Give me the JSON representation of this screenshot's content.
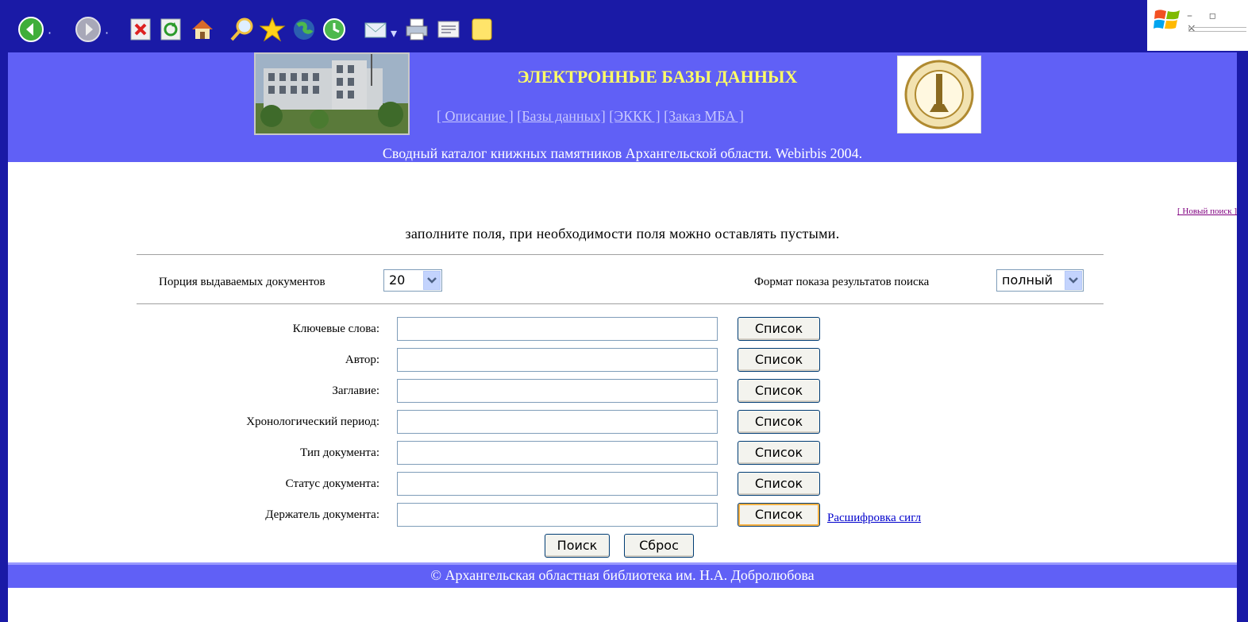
{
  "toolbar": {
    "items": [
      {
        "name": "back-icon",
        "dropdown": true
      },
      {
        "name": "forward-icon",
        "dropdown": true
      },
      {
        "name": "stop-icon"
      },
      {
        "name": "refresh-icon"
      },
      {
        "name": "home-icon"
      },
      {
        "name": "search-icon"
      },
      {
        "name": "favorites-icon"
      },
      {
        "name": "media-icon"
      },
      {
        "name": "history-icon"
      },
      {
        "name": "mail-icon",
        "dropdown": true
      },
      {
        "name": "print-icon"
      },
      {
        "name": "edit-icon"
      },
      {
        "name": "discuss-icon"
      }
    ],
    "window_controls": "– ▫ ×"
  },
  "header": {
    "title": "ЭЛЕКТРОННЫЕ БАЗЫ ДАННЫХ",
    "nav": [
      {
        "label": "[ Описание ]"
      },
      {
        "label": "[Базы данных]"
      },
      {
        "label": "[ЭККК ]"
      },
      {
        "label": "[Заказ МБА ]"
      }
    ],
    "subtitle": "Сводный каталог книжных памятников Архангельской области. Webirbis 2004."
  },
  "new_search": "[ Новый поиск ]",
  "instruction": "заполните поля, при необходимости поля можно оставлять пустыми.",
  "options": {
    "portion_label": "Порция выдаваемых документов",
    "portion_value": "20",
    "format_label": "Формат показа результатов поиска",
    "format_value": "полный"
  },
  "fields": [
    {
      "label": "Ключевые слова:",
      "value": "",
      "list_button": "Список"
    },
    {
      "label": "Автор:",
      "value": "",
      "list_button": "Список"
    },
    {
      "label": "Заглавие:",
      "value": "",
      "list_button": "Список"
    },
    {
      "label": "Хронологический период:",
      "value": "",
      "list_button": "Список"
    },
    {
      "label": "Тип документа:",
      "value": "",
      "list_button": "Список"
    },
    {
      "label": "Статус документа:",
      "value": "",
      "list_button": "Список"
    },
    {
      "label": "Держатель документа:",
      "value": "",
      "list_button": "Список"
    }
  ],
  "decode_link": "Расшифровка сигл",
  "search_button": "Поиск",
  "reset_button": "Сброс",
  "footer": "© Архангельская областная библиотека им. Н.А. Добролюбова",
  "colors": {
    "frame": "#1a1aa6",
    "header_bg": "#6060f6",
    "title": "#ffff66"
  }
}
